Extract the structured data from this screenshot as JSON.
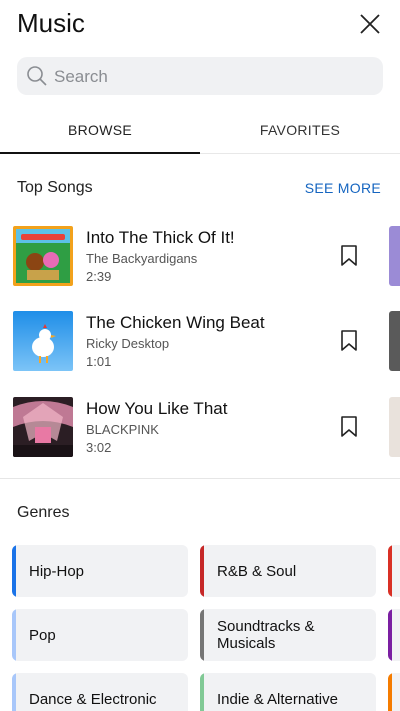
{
  "header": {
    "title": "Music"
  },
  "search": {
    "placeholder": "Search"
  },
  "tabs": [
    {
      "label": "BROWSE",
      "active": true
    },
    {
      "label": "FAVORITES",
      "active": false
    }
  ],
  "top_songs": {
    "title": "Top Songs",
    "see_more": "SEE MORE",
    "items": [
      {
        "title": "Into The Thick Of It!",
        "artist": "The Backyardigans",
        "duration": "2:39"
      },
      {
        "title": "The Chicken Wing Beat",
        "artist": "Ricky Desktop",
        "duration": "1:01"
      },
      {
        "title": "How You Like That",
        "artist": "BLACKPINK",
        "duration": "3:02"
      }
    ]
  },
  "genres": {
    "title": "Genres",
    "items": [
      {
        "label": "Hip-Hop",
        "color": "#1a73e8"
      },
      {
        "label": "R&B & Soul",
        "color": "#c62828"
      },
      {
        "label": "Pop",
        "color": "#a8c7fa"
      },
      {
        "label": "Soundtracks & Musicals",
        "color": "#757575"
      },
      {
        "label": "Dance & Electronic",
        "color": "#a8c7fa"
      },
      {
        "label": "Indie & Alternative",
        "color": "#81c995"
      }
    ],
    "peek_colors": [
      "#d93025",
      "#7b1fa2",
      "#f57c00"
    ]
  },
  "icons": {
    "close": "close-icon",
    "search": "search-icon",
    "bookmark": "bookmark-icon"
  }
}
